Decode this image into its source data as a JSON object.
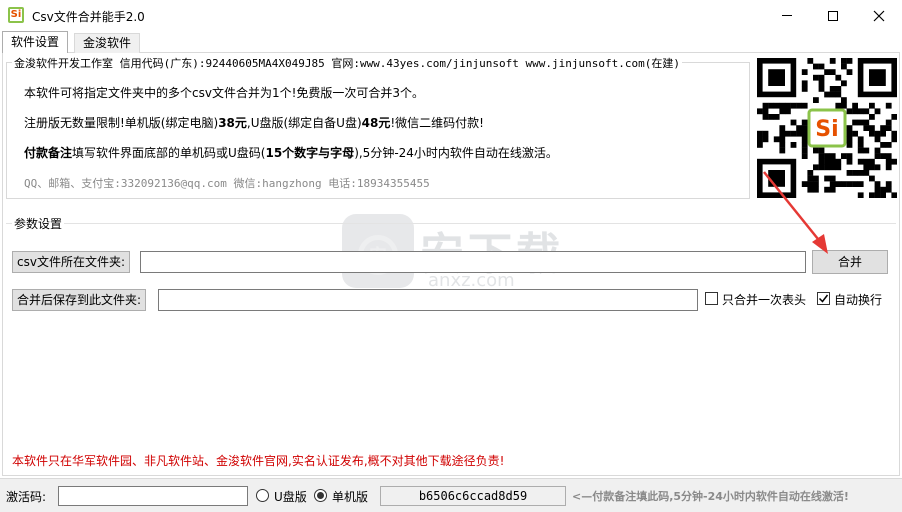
{
  "window": {
    "title": "Csv文件合并能手2.0",
    "icon_text": "Si",
    "controls": [
      "minimize",
      "maximize",
      "close"
    ]
  },
  "tabs": [
    {
      "label": "软件设置",
      "active": true
    },
    {
      "label": "金浚软件",
      "active": false
    }
  ],
  "info": {
    "legend": "金浚软件开发工作室 信用代码(广东):92440605MA4X049J85 官网:www.43yes.com/jinjunsoft  www.jinjunsoft.com(在建)",
    "line1": "本软件可将指定文件夹中的多个csv文件合并为1个!免费版一次可合并3个。",
    "line2": {
      "a": "注册版无数量限制!单机版(绑定电脑)",
      "b": "38元",
      "c": ",U盘版(绑定自备U盘)",
      "d": "48元",
      "e": "!微信二维码付款!"
    },
    "line3": {
      "a": "付款备注",
      "b": "填写软件界面底部的单机码或U盘码(",
      "c": "15个数字与字母",
      "d": "),5分钟-24小时内软件自动在线激活。"
    },
    "line4": "QQ、邮箱、支付宝:332092136@qq.com  微信:hangzhong  电话:18934355455"
  },
  "params": {
    "legend": "参数设置",
    "csv_folder_label": "csv文件所在文件夹:",
    "csv_folder_value": "",
    "save_folder_label": "合并后保存到此文件夹:",
    "save_folder_value": "",
    "merge_button": "合并",
    "header_once": {
      "label": "只合并一次表头",
      "checked": false
    },
    "auto_wrap": {
      "label": "自动换行",
      "checked": true
    }
  },
  "watermark": {
    "cn": "安下载",
    "en": "anxz.com"
  },
  "notice": "本软件只在华军软件园、非凡软件站、金浚软件官网,实名认证发布,概不对其他下载途径负责!",
  "footer": {
    "activation_label": "激活码:",
    "activation_value": "",
    "radio_udisk": "U盘版",
    "radio_machine": "单机版",
    "selected": "单机版",
    "machine_code": "b6506c6ccad8d59",
    "hint": "<—付款备注填此码,5分钟-24小时内软件自动在线激活!"
  },
  "colors": {
    "notice": "#d00000",
    "arrow": "#e53935",
    "hint": "#8a8a8a"
  }
}
